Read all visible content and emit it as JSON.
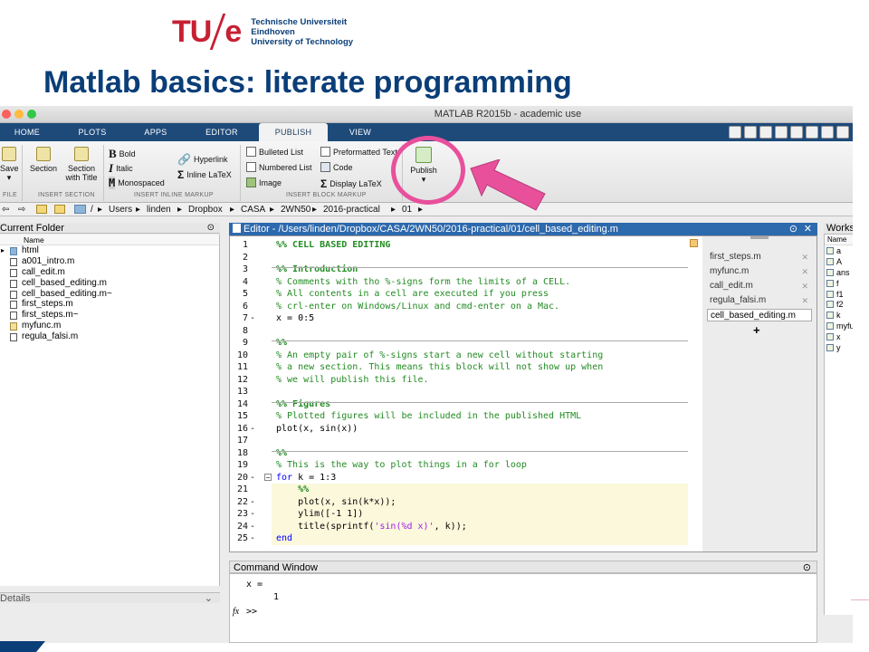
{
  "slide": {
    "logo_mark_tu": "TU",
    "logo_mark_e": "e",
    "logo_lines": [
      "Technische Universiteit",
      "Eindhoven",
      "University of Technology"
    ],
    "title": "Matlab basics: literate programming"
  },
  "window": {
    "title": "MATLAB R2015b - academic use",
    "traffic_lights": [
      "#fc605c",
      "#fdbc40",
      "#34c84a"
    ]
  },
  "ribbon_tabs": [
    {
      "label": "HOME",
      "active": false
    },
    {
      "label": "PLOTS",
      "active": false
    },
    {
      "label": "APPS",
      "active": false
    },
    {
      "label": "EDITOR",
      "active": false
    },
    {
      "label": "PUBLISH",
      "active": true
    },
    {
      "label": "VIEW",
      "active": false
    }
  ],
  "ribbon": {
    "save": "Save",
    "section": "Section",
    "section_with_title": [
      "Section",
      "with Title"
    ],
    "bold": "Bold",
    "italic": "Italic",
    "monospaced": "Monospaced",
    "hyperlink": "Hyperlink",
    "inline_latex": "Inline LaTeX",
    "bulleted_list": "Bulleted List",
    "numbered_list": "Numbered List",
    "image": "Image",
    "preformatted_text": "Preformatted Text",
    "code": "Code",
    "display_latex": "Display LaTeX",
    "publish": "Publish",
    "groups": {
      "file": "FILE",
      "insert_section": "INSERT SECTION",
      "insert_inline_markup": "INSERT INLINE MARKUP",
      "insert_block_markup": "INSERT BLOCK MARKUP"
    }
  },
  "path": [
    "/",
    "Users",
    "linden",
    "Dropbox",
    "CASA",
    "2WN50",
    "2016-practical",
    "01"
  ],
  "current_folder": {
    "title": "Current Folder",
    "col_name": "Name",
    "items": [
      {
        "name": "html",
        "kind": "folder"
      },
      {
        "name": "a001_intro.m",
        "kind": "script"
      },
      {
        "name": "call_edit.m",
        "kind": "script"
      },
      {
        "name": "cell_based_editing.m",
        "kind": "script"
      },
      {
        "name": "cell_based_editing.m~",
        "kind": "script"
      },
      {
        "name": "first_steps.m",
        "kind": "script"
      },
      {
        "name": "first_steps.m~",
        "kind": "script"
      },
      {
        "name": "myfunc.m",
        "kind": "function"
      },
      {
        "name": "regula_falsi.m",
        "kind": "script"
      }
    ],
    "details": "Details"
  },
  "editor": {
    "title": "Editor - /Users/linden/Dropbox/CASA/2WN50/2016-practical/01/cell_based_editing.m",
    "lines": [
      {
        "n": "1",
        "dash": "",
        "text": "%% CELL BASED EDITING",
        "cls": "cmb"
      },
      {
        "n": "2",
        "dash": "",
        "text": "",
        "cls": ""
      },
      {
        "n": "3",
        "dash": "",
        "text": "%% Introduction",
        "cls": "cmb"
      },
      {
        "n": "4",
        "dash": "",
        "text": "% Comments with tho %-signs form the limits of a CELL.",
        "cls": "cm"
      },
      {
        "n": "5",
        "dash": "",
        "text": "% All contents in a cell are executed if you press",
        "cls": "cm"
      },
      {
        "n": "6",
        "dash": "",
        "text": "% crl-enter on Windows/Linux and cmd-enter on a Mac.",
        "cls": "cm"
      },
      {
        "n": "7",
        "dash": "-",
        "text": "x = 0:5",
        "cls": ""
      },
      {
        "n": "8",
        "dash": "",
        "text": "",
        "cls": ""
      },
      {
        "n": "9",
        "dash": "",
        "text": "%%",
        "cls": "cmb"
      },
      {
        "n": "10",
        "dash": "",
        "text": "% An empty pair of %-signs start a new cell without starting",
        "cls": "cm"
      },
      {
        "n": "11",
        "dash": "",
        "text": "% a new section. This means this block will not show up when",
        "cls": "cm"
      },
      {
        "n": "12",
        "dash": "",
        "text": "% we will publish this file.",
        "cls": "cm"
      },
      {
        "n": "13",
        "dash": "",
        "text": "",
        "cls": ""
      },
      {
        "n": "14",
        "dash": "",
        "text": "%% Figures",
        "cls": "cmb"
      },
      {
        "n": "15",
        "dash": "",
        "text": "% Plotted figures will be included in the published HTML",
        "cls": "cm"
      },
      {
        "n": "16",
        "dash": "-",
        "text": "plot(x, sin(x))",
        "cls": ""
      },
      {
        "n": "17",
        "dash": "",
        "text": "",
        "cls": ""
      },
      {
        "n": "18",
        "dash": "",
        "text": "%%",
        "cls": "cmb"
      },
      {
        "n": "19",
        "dash": "",
        "text": "% This is the way to plot things in a for loop",
        "cls": "cm"
      },
      {
        "n": "20",
        "dash": "-",
        "text": "for k = 1:3",
        "cls": "for"
      },
      {
        "n": "21",
        "dash": "",
        "text": "    %%",
        "cls": "cmb"
      },
      {
        "n": "22",
        "dash": "-",
        "text": "    plot(x, sin(k*x));",
        "cls": ""
      },
      {
        "n": "23",
        "dash": "-",
        "text": "    ylim([-1 1])",
        "cls": ""
      },
      {
        "n": "24",
        "dash": "-",
        "text": "    title(sprintf('sin(%d x)', k));",
        "cls": "title"
      },
      {
        "n": "25",
        "dash": "-",
        "text": "end",
        "cls": "kw"
      }
    ],
    "open_files": [
      "first_steps.m",
      "myfunc.m",
      "call_edit.m",
      "regula_falsi.m",
      "cell_based_editing.m"
    ],
    "active_file": "cell_based_editing.m",
    "add_label": "+"
  },
  "workspace": {
    "title": "Workspace",
    "col_name": "Name",
    "vars": [
      "a",
      "A",
      "ans",
      "f",
      "f1",
      "f2",
      "k",
      "myfunc",
      "x",
      "y"
    ]
  },
  "command_window": {
    "title": "Command Window",
    "output_var": "x =",
    "output_value": "1",
    "fx": "fx",
    "prompt": ">>"
  },
  "colors": {
    "tue_red": "#c72032",
    "tue_blue": "#0a3e78",
    "highlight_pink": "#e8509c",
    "editor_header": "#2d69ad"
  }
}
